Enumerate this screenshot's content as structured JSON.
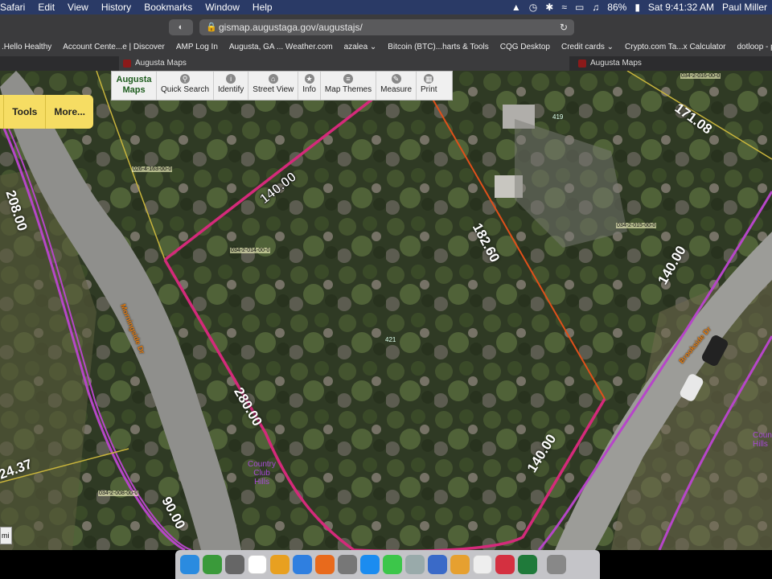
{
  "menubar": {
    "app_items": [
      "Safari",
      "Edit",
      "View",
      "History",
      "Bookmarks",
      "Window",
      "Help"
    ],
    "battery": "86%",
    "clock": "Sat 9:41:32 AM",
    "user": "Paul Miller"
  },
  "browser": {
    "url": "gismap.augustaga.gov/augustajs/",
    "bookmarks": [
      ".Hello Healthy",
      "Account Cente...e | Discover",
      "AMP Log In",
      "Augusta, GA ... Weather.com",
      "azalea ⌄",
      "Bitcoin (BTC)...harts & Tools",
      "CQG Desktop",
      "Credit cards ⌄",
      "Crypto.com Ta...x Calculator",
      "dotloop - peo...ot paperwo"
    ],
    "tabs": [
      {
        "title": "Augusta Maps"
      },
      {
        "title": "Augusta Maps"
      }
    ]
  },
  "map_toolbar": {
    "logo_line1": "Augusta",
    "logo_line2": "Maps",
    "buttons": [
      {
        "label": "Quick Search",
        "icon": "search-icon"
      },
      {
        "label": "Identify",
        "icon": "info-circle-icon"
      },
      {
        "label": "Street View",
        "icon": "home-icon"
      },
      {
        "label": "Info",
        "icon": "star-icon"
      },
      {
        "label": "Map Themes",
        "icon": "list-icon"
      },
      {
        "label": "Measure",
        "icon": "pencil-icon"
      },
      {
        "label": "Print",
        "icon": "grid-icon"
      }
    ]
  },
  "side_tools": {
    "tools": "Tools",
    "more": "More..."
  },
  "side_chip": "mi",
  "map": {
    "dimensions": {
      "north": "140.00",
      "east": "182.60",
      "south": "140.00",
      "west": "280.00",
      "left_top": "208.00",
      "left_bottom": "24.37",
      "bottom_left": "90.00",
      "right_top": "171.08",
      "right_mid": "140.00"
    },
    "parcel_ids": {
      "main": "034-2-014-00-0",
      "nw": "026-4-163-00-0",
      "east": "034-2-015-00-0",
      "ne": "034-2-016-00-0",
      "sw": "034-2-008-00-0"
    },
    "house_numbers": {
      "main": "421",
      "ne": "419"
    },
    "streets": {
      "west": "Morningside Dr",
      "east": "Brookside Dr"
    },
    "area_labels": {
      "line1": "Country",
      "line2": "Club",
      "line3": "Hills",
      "east_line1": "Coun",
      "east_line2": "Hills"
    }
  }
}
